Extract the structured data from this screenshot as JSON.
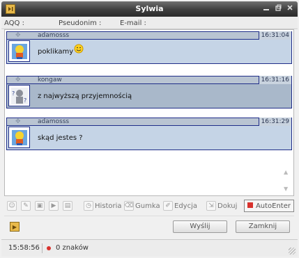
{
  "window": {
    "title": "Sylwia",
    "minimize_icon": "minimize-icon",
    "restore_icon": "restore-icon",
    "close_icon": "close-icon"
  },
  "info": {
    "aqq_label": "AQQ :",
    "pseudonim_label": "Pseudonim :",
    "email_label": "E-mail :"
  },
  "messages": [
    {
      "nick": "adamosss",
      "time": "16:31:04",
      "text": "poklikamy",
      "emoticon": "smiley-icon"
    },
    {
      "nick": "kongaw",
      "time": "16:31:16",
      "text": "z najwyższą przyjemnością"
    },
    {
      "nick": "adamosss",
      "time": "16:31:29",
      "text": "skąd jestes ?"
    }
  ],
  "toolbar": {
    "historia": "Historia",
    "gumka": "Gumka",
    "edycja": "Edycja",
    "dokuj": "Dokuj",
    "autoenter": "AutoEnter"
  },
  "buttons": {
    "send": "Wyślij",
    "close": "Zamknij"
  },
  "status": {
    "time": "15:58:56",
    "chars": "0 znaków"
  }
}
